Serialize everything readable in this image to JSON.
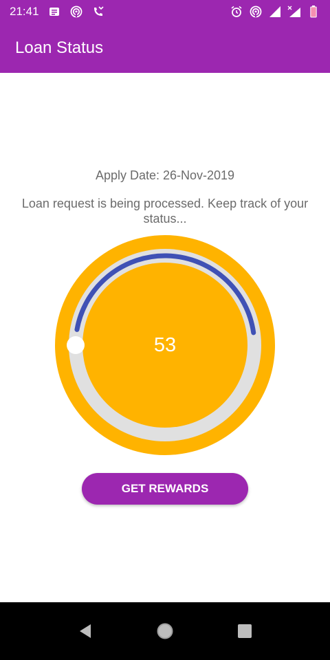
{
  "status_bar": {
    "time": "21:41",
    "left_icons": [
      "message-icon",
      "hotspot-icon",
      "missed-call-icon"
    ],
    "right_icons": [
      "alarm-icon",
      "hotspot-icon",
      "signal-icon",
      "signal-x-icon",
      "battery-icon"
    ]
  },
  "app_bar": {
    "title": "Loan Status"
  },
  "content": {
    "apply_date": "Apply Date: 26-Nov-2019",
    "message": "Loan request is being processed. Keep track of your status..."
  },
  "gauge": {
    "value": "53",
    "progress_fraction": 0.45,
    "colors": {
      "outer": "#ffb300",
      "track": "#e0e0e0",
      "progress": "#3f51b5",
      "inner": "#ffb300",
      "knob": "#ffffff"
    }
  },
  "actions": {
    "rewards_label": "GET REWARDS"
  },
  "nav_bar": {
    "items": [
      "back-icon",
      "home-icon",
      "recents-icon"
    ]
  },
  "colors": {
    "primary": "#9c27b0",
    "text_gray": "#6b6b6b"
  }
}
